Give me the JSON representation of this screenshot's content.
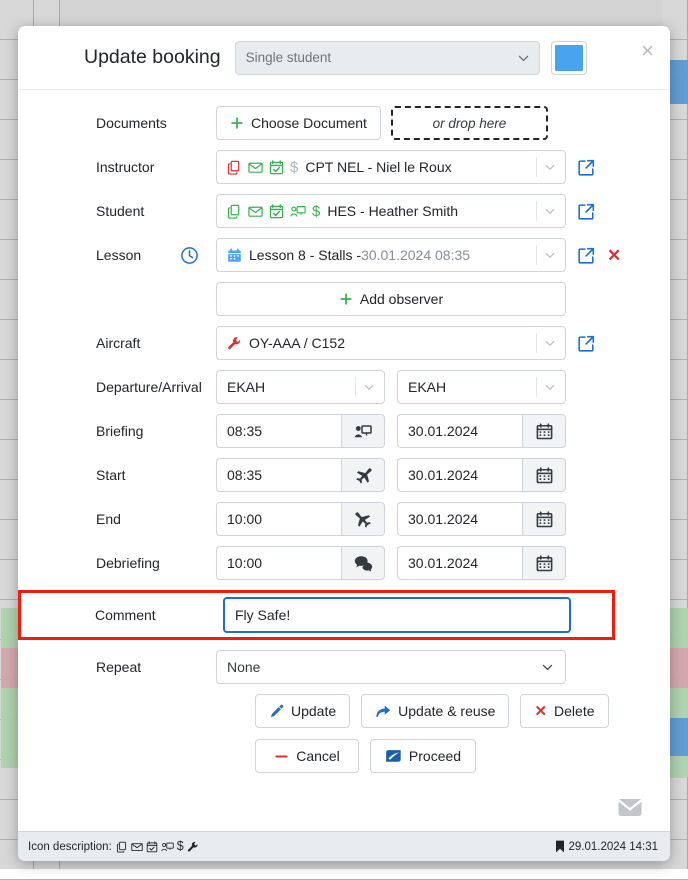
{
  "dialog": {
    "title": "Update booking",
    "booking_type": "Single student",
    "color_swatch": "#4aa3ee",
    "close_label": "×"
  },
  "rows": {
    "documents": {
      "label": "Documents",
      "choose_button": "Choose Document",
      "drop_zone": "or drop here"
    },
    "instructor": {
      "label": "Instructor",
      "value": "CPT NEL - Niel le Roux",
      "icons": [
        "copy-icon",
        "envelope-icon",
        "calendar-check-icon",
        "dollar-icon"
      ]
    },
    "student": {
      "label": "Student",
      "value": "HES - Heather Smith",
      "icons": [
        "copy-icon",
        "envelope-icon",
        "calendar-check-icon",
        "presentation-icon",
        "dollar-icon"
      ]
    },
    "lesson": {
      "label": "Lesson",
      "value_main": "Lesson 8 - Stalls - ",
      "value_muted": "30.01.2024 08:35"
    },
    "observer": {
      "add_label": "Add observer"
    },
    "aircraft": {
      "label": "Aircraft",
      "value": "OY-AAA / C152"
    },
    "departure_arrival": {
      "label": "Departure/Arrival",
      "departure": "EKAH",
      "arrival": "EKAH"
    },
    "briefing": {
      "label": "Briefing",
      "time": "08:35",
      "date": "30.01.2024"
    },
    "start": {
      "label": "Start",
      "time": "08:35",
      "date": "30.01.2024"
    },
    "end": {
      "label": "End",
      "time": "10:00",
      "date": "30.01.2024"
    },
    "debriefing": {
      "label": "Debriefing",
      "time": "10:00",
      "date": "30.01.2024"
    },
    "comment": {
      "label": "Comment",
      "value": "Fly Safe!"
    },
    "repeat": {
      "label": "Repeat",
      "value": "None"
    }
  },
  "buttons": {
    "update": "Update",
    "update_reuse": "Update & reuse",
    "delete": "Delete",
    "cancel": "Cancel",
    "proceed": "Proceed"
  },
  "footer": {
    "legend_label": "Icon description:",
    "legend_icons": [
      "copy-icon",
      "envelope-icon",
      "calendar-check-icon",
      "presentation-icon",
      "dollar-icon",
      "wrench-icon"
    ],
    "timestamp": "29.01.2024 14:31"
  },
  "colors": {
    "accent_blue": "#1c6fd0",
    "green": "#37b24d",
    "red": "#e03131",
    "highlight_red": "#f01c0e",
    "muted": "#868e96"
  }
}
